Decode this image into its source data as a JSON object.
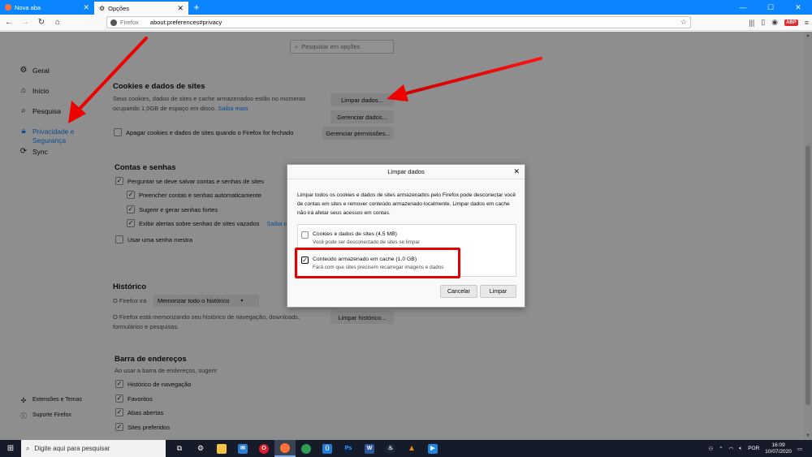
{
  "tabs": [
    {
      "label": "Nova aba",
      "icon": "firefox-icon"
    },
    {
      "label": "Opções",
      "icon": "gear-icon"
    }
  ],
  "urlbar": {
    "identity": "Firefox",
    "url": "about:preferences#privacy"
  },
  "search": {
    "placeholder": "Pesquisar em opções"
  },
  "sidebar": {
    "items": [
      {
        "label": "Geral",
        "icon": "gear-icon"
      },
      {
        "label": "Início",
        "icon": "home-icon"
      },
      {
        "label": "Pesquisa",
        "icon": "search-icon"
      },
      {
        "label": "Privacidade e Segurança",
        "icon": "lock-icon"
      },
      {
        "label": "Sync",
        "icon": "sync-icon"
      }
    ],
    "bottom": [
      {
        "label": "Extensões e Temas",
        "icon": "puzzle-icon"
      },
      {
        "label": "Suporte Firefox",
        "icon": "help-icon"
      }
    ]
  },
  "cookies": {
    "title": "Cookies e dados de sites",
    "desc_1": "Seus cookies, dados de sites e cache armazenados estão no momento",
    "desc_2": "ocupando 1,0GB de espaço em disco.",
    "learn_more": "Saiba mais",
    "delete_on_close": "Apagar cookies e dados de sites quando o Firefox for fechado",
    "btn_clear": "Limpar dados...",
    "btn_manage": "Gerenciar dados...",
    "btn_permissions": "Gerenciar permissões..."
  },
  "logins": {
    "title": "Contas e senhas",
    "ask_save": "Perguntar se deve salvar contas e senhas de sites",
    "autofill": "Preencher contas e senhas automaticamente",
    "suggest": "Sugerir e gerar senhas fortes",
    "alerts": "Exibir alertas sobre senhas de sites vazados",
    "alerts_link": "Saiba m",
    "master": "Usar uma senha mestra"
  },
  "history": {
    "title": "Histórico",
    "will_label": "O Firefox irá",
    "mode": "Memorizar todo o histórico",
    "desc_1": "O Firefox está memorizando seu histórico de navegação, downloads,",
    "desc_2": "formulários e pesquisas.",
    "btn_clear": "Limpar histórico..."
  },
  "addressbar": {
    "title": "Barra de endereços",
    "desc": "Ao usar a barra de endereços, sugerir",
    "opt_history": "Histórico de navegação",
    "opt_bookmarks": "Favoritos",
    "opt_tabs": "Abas abertas",
    "opt_top": "Sites preferidos"
  },
  "dialog": {
    "title": "Limpar dados",
    "text": "Limpar todos os cookies e dados de sites armazenados pelo Firefox pode desconectar você de contas em sites e remover conteúdo armazenado localmente. Limpar dados em cache não irá afetar seus acessos em contas.",
    "opt1_label": "Cookies e dados de sites (4,5 MB)",
    "opt1_sub": "Você pode ser desconectado de sites se limpar",
    "opt1_checked": false,
    "opt2_label": "Conteúdo armazenado em cache (1,0 GB)",
    "opt2_sub": "Fará com que sites precisem recarregar imagens e dados",
    "opt2_checked": true,
    "cancel": "Cancelar",
    "clear": "Limpar"
  },
  "taskbar": {
    "search_placeholder": "Digite aqui para pesquisar",
    "lang": "POR",
    "time": "16:09",
    "date": "10/07/2020"
  },
  "colors": {
    "accent": "#0a84ff",
    "highlight": "#e30000"
  }
}
